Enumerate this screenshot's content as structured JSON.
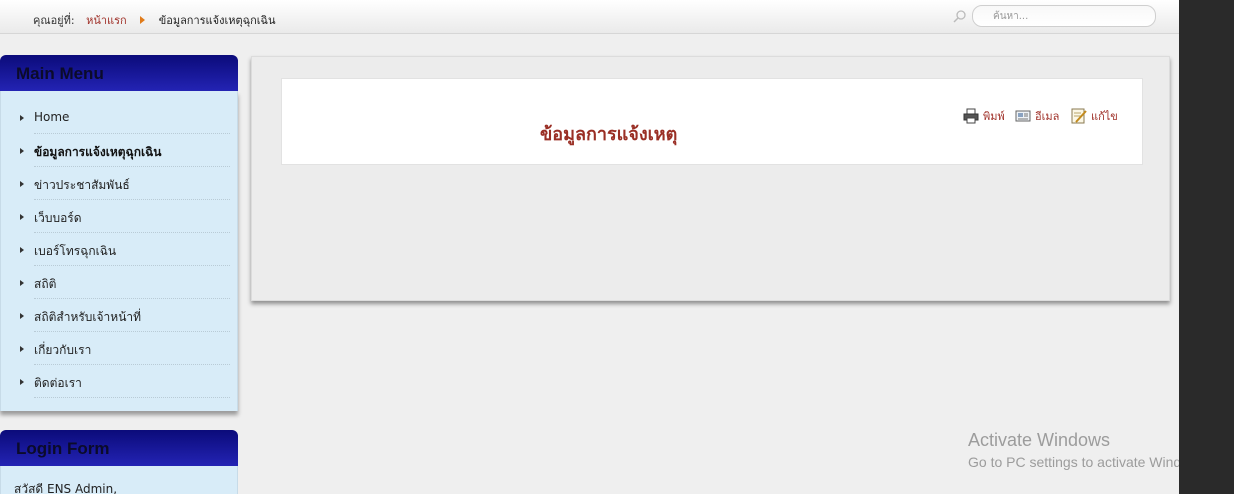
{
  "breadcrumb": {
    "prefix": "คุณอยู่ที่:",
    "home": "หน้าแรก",
    "current": "ข้อมูลการแจ้งเหตุฉุกเฉิน"
  },
  "search": {
    "placeholder": "ค้นหา..."
  },
  "main_menu": {
    "title": "Main Menu",
    "items": [
      {
        "label": "Home"
      },
      {
        "label": "ข้อมูลการแจ้งเหตุฉุกเฉิน"
      },
      {
        "label": "ข่าวประชาสัมพันธ์"
      },
      {
        "label": "เว็บบอร์ด"
      },
      {
        "label": "เบอร์โทรฉุกเฉิน"
      },
      {
        "label": "สถิติ"
      },
      {
        "label": "สถิติสำหรับเจ้าหน้าที่"
      },
      {
        "label": "เกี่ยวกับเรา"
      },
      {
        "label": "ติดต่อเรา"
      }
    ]
  },
  "login_form": {
    "title": "Login Form",
    "greeting": "สวัสดี ENS Admin,"
  },
  "article": {
    "title": "ข้อมูลการแจ้งเหตุ",
    "tools": {
      "print": "พิมพ์",
      "email": "อีเมล",
      "edit": "แก้ไข"
    }
  },
  "watermark": {
    "title": "Activate Windows",
    "subtitle": "Go to PC settings to activate Windows."
  },
  "colors": {
    "menu_header": "#1a1aa0",
    "menu_bg": "#d8ecf8",
    "link": "#a0322a",
    "breadcrumb_arrow": "#e07b1a"
  },
  "icons": {
    "search": "magnifier-icon",
    "print": "printer-icon",
    "email": "email-icon",
    "edit": "edit-icon",
    "menu_bullet": "triangle-right-icon"
  }
}
